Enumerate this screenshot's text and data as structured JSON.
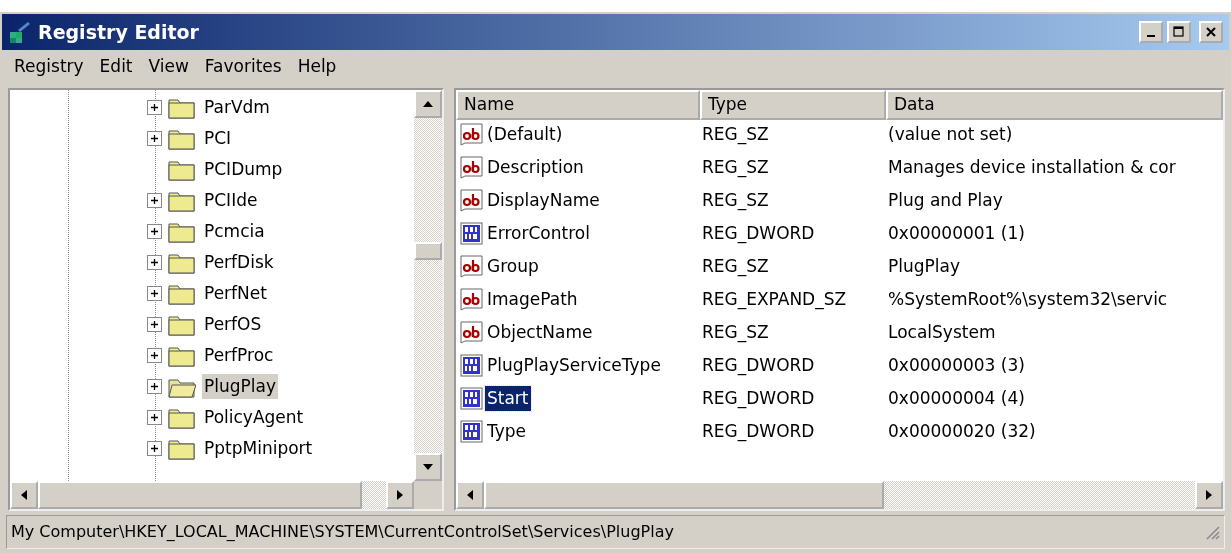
{
  "window": {
    "title": "Registry Editor"
  },
  "menu": [
    "Registry",
    "Edit",
    "View",
    "Favorites",
    "Help"
  ],
  "tree": [
    {
      "label": "ParVdm",
      "expandable": true,
      "selected": false
    },
    {
      "label": "PCI",
      "expandable": true,
      "selected": false
    },
    {
      "label": "PCIDump",
      "expandable": false,
      "selected": false
    },
    {
      "label": "PCIIde",
      "expandable": true,
      "selected": false
    },
    {
      "label": "Pcmcia",
      "expandable": true,
      "selected": false
    },
    {
      "label": "PerfDisk",
      "expandable": true,
      "selected": false
    },
    {
      "label": "PerfNet",
      "expandable": true,
      "selected": false
    },
    {
      "label": "PerfOS",
      "expandable": true,
      "selected": false
    },
    {
      "label": "PerfProc",
      "expandable": true,
      "selected": false
    },
    {
      "label": "PlugPlay",
      "expandable": true,
      "selected": true
    },
    {
      "label": "PolicyAgent",
      "expandable": true,
      "selected": false
    },
    {
      "label": "PptpMiniport",
      "expandable": true,
      "selected": false
    }
  ],
  "table": {
    "columns": [
      "Name",
      "Type",
      "Data"
    ],
    "rows": [
      {
        "kind": "string",
        "name": "(Default)",
        "type": "REG_SZ",
        "data": "(value not set)",
        "selected": false
      },
      {
        "kind": "string",
        "name": "Description",
        "type": "REG_SZ",
        "data": "Manages device installation & cor",
        "selected": false
      },
      {
        "kind": "string",
        "name": "DisplayName",
        "type": "REG_SZ",
        "data": "Plug and Play",
        "selected": false
      },
      {
        "kind": "binary",
        "name": "ErrorControl",
        "type": "REG_DWORD",
        "data": "0x00000001 (1)",
        "selected": false
      },
      {
        "kind": "string",
        "name": "Group",
        "type": "REG_SZ",
        "data": "PlugPlay",
        "selected": false
      },
      {
        "kind": "string",
        "name": "ImagePath",
        "type": "REG_EXPAND_SZ",
        "data": "%SystemRoot%\\system32\\servic",
        "selected": false
      },
      {
        "kind": "string",
        "name": "ObjectName",
        "type": "REG_SZ",
        "data": "LocalSystem",
        "selected": false
      },
      {
        "kind": "binary",
        "name": "PlugPlayServiceType",
        "type": "REG_DWORD",
        "data": "0x00000003 (3)",
        "selected": false
      },
      {
        "kind": "binary",
        "name": "Start",
        "type": "REG_DWORD",
        "data": "0x00000004 (4)",
        "selected": true
      },
      {
        "kind": "binary",
        "name": "Type",
        "type": "REG_DWORD",
        "data": "0x00000020 (32)",
        "selected": false
      }
    ]
  },
  "status_bar": "My Computer\\HKEY_LOCAL_MACHINE\\SYSTEM\\CurrentControlSet\\Services\\PlugPlay"
}
